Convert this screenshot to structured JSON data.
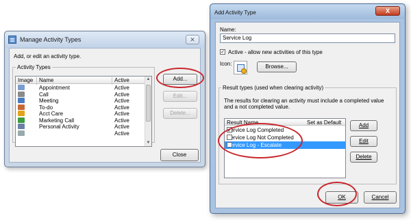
{
  "manage_dialog": {
    "title": "Manage Activity Types",
    "close_label": "✕",
    "instructions": "Add, or edit an activity type.",
    "group_label": "Activity Types",
    "columns": [
      "Image",
      "Name",
      "Active"
    ],
    "rows": [
      {
        "name": "Appointment",
        "active": "Active",
        "icon_color": "#7a9ccf"
      },
      {
        "name": "Call",
        "active": "Active",
        "icon_color": "#8a8a8a"
      },
      {
        "name": "Meeting",
        "active": "Active",
        "icon_color": "#4a7cc0"
      },
      {
        "name": "To-do",
        "active": "Active",
        "icon_color": "#c56a36"
      },
      {
        "name": "Acct Care",
        "active": "Active",
        "icon_color": "#e3a21a"
      },
      {
        "name": "Marketing Call",
        "active": "Active",
        "icon_color": "#3d9b3d"
      },
      {
        "name": "Personal Activity",
        "active": "Active",
        "icon_color": "#6b7fa8"
      },
      {
        "name": "",
        "active": "Active",
        "icon_color": "#9aa"
      }
    ],
    "buttons": {
      "add": "Add...",
      "edit": "Edit...",
      "delete": "Delete...",
      "close": "Close"
    }
  },
  "add_dialog": {
    "title": "Add Activity Type",
    "close_label": "X",
    "name_label": "Name:",
    "name_value": "Service Log",
    "active_checked": true,
    "active_label": "Active - allow new activities of this type",
    "icon_label": "Icon:",
    "browse_label": "Browse...",
    "results_group_label": "Result types (used when clearing activity)",
    "results_description": "The results for clearing an activity must include a completed value and a not completed value.",
    "results_columns": [
      "Result Name",
      "Set as Default"
    ],
    "results": [
      {
        "name": "Service Log Completed",
        "is_default": true,
        "selected": false
      },
      {
        "name": "Service Log Not Completed",
        "is_default": false,
        "selected": false
      },
      {
        "name": "Service Log - Escalate",
        "is_default": false,
        "selected": true
      }
    ],
    "buttons": {
      "add": "Add",
      "edit": "Edit",
      "delete": "Delete",
      "ok": "OK",
      "cancel": "Cancel"
    }
  },
  "colors": {
    "annotation_red": "#c8262c",
    "selection_blue": "#3399ff"
  }
}
